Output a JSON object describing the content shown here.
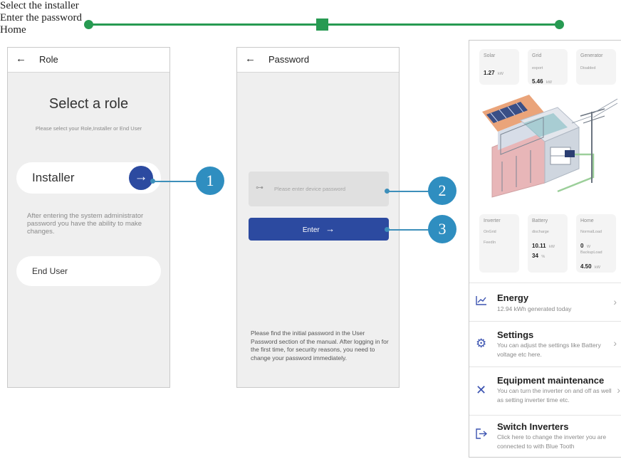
{
  "steps": [
    {
      "label": "Select the installer"
    },
    {
      "label": "Enter the password"
    },
    {
      "label": "Home"
    }
  ],
  "colors": {
    "progress": "#279a52",
    "primary_button": "#2c4aa0",
    "callout": "#2f8ec0"
  },
  "role_screen": {
    "back_icon": "arrow-left-icon",
    "title": "Role",
    "heading": "Select a role",
    "subheading": "Please select your Role,Installer or End User",
    "installer_label": "Installer",
    "installer_icon": "arrow-right-icon",
    "installer_note": "After entering the system administrator password you have the ability to make changes.",
    "end_user_label": "End User"
  },
  "password_screen": {
    "back_icon": "arrow-left-icon",
    "title": "Password",
    "key_icon": "key-icon",
    "placeholder": "Please enter device password",
    "enter_label": "Enter",
    "note": "Please find the initial password in the User Password section of the manual. After logging in for the first time, for security reasons, you need to change your password immediately."
  },
  "callouts": [
    "1",
    "2",
    "3"
  ],
  "home_screen": {
    "top_cards": [
      {
        "label": "Solar",
        "lines": [],
        "value": "1.27",
        "unit": "kW"
      },
      {
        "label": "Grid",
        "lines": [
          "export"
        ],
        "value": "5.46",
        "unit": "kW"
      },
      {
        "label": "Generator",
        "lines": [
          "Disabled"
        ],
        "value": "",
        "unit": ""
      }
    ],
    "inverter_card": {
      "label": "Inverter",
      "line1": "OnGrid",
      "line2": "FeedIn"
    },
    "battery_card": {
      "label": "Battery",
      "status": "discharge",
      "power": "10.11",
      "power_unit": "kW",
      "soc": "34",
      "soc_unit": "%"
    },
    "home_card": {
      "label": "Home",
      "normal_label": "NormalLoad",
      "normal_value": "0",
      "normal_unit": "W",
      "backup_label": "BackupLoad",
      "backup_value": "4.50",
      "backup_unit": "kW"
    },
    "menu": [
      {
        "icon": "chart-icon",
        "title": "Energy",
        "desc": "12.94 kWh generated today"
      },
      {
        "icon": "gear-icon",
        "title": "Settings",
        "desc": "You can adjust the settings like Battery voltage etc here."
      },
      {
        "icon": "tools-icon",
        "title": "Equipment maintenance",
        "desc": "You can turn the inverter on and off as well as setting inverter time etc."
      },
      {
        "icon": "logout-icon",
        "title": "Switch Inverters",
        "desc": "Click here to change the inverter you are connected to with Blue Tooth"
      }
    ]
  }
}
